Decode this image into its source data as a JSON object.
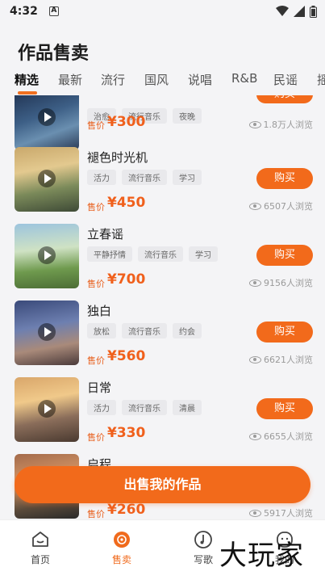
{
  "statusbar": {
    "time": "4:32"
  },
  "page": {
    "title": "作品售卖"
  },
  "tabs": [
    "精选",
    "最新",
    "流行",
    "国风",
    "说唱",
    "R&B",
    "民谣",
    "摇"
  ],
  "items": [
    {
      "title": "",
      "tags": [
        "治愈",
        "流行音乐",
        "夜晚"
      ],
      "price_label": "售价",
      "price": "¥300",
      "views": "1.8万人浏览",
      "buy": "购买"
    },
    {
      "title": "褪色时光机",
      "tags": [
        "活力",
        "流行音乐",
        "学习"
      ],
      "price_label": "售价",
      "price": "¥450",
      "views": "6507人浏览",
      "buy": "购买"
    },
    {
      "title": "立春谣",
      "tags": [
        "平静抒情",
        "流行音乐",
        "学习"
      ],
      "price_label": "售价",
      "price": "¥700",
      "views": "9156人浏览",
      "buy": "购买"
    },
    {
      "title": "独白",
      "tags": [
        "放松",
        "流行音乐",
        "约会"
      ],
      "price_label": "售价",
      "price": "¥560",
      "views": "6621人浏览",
      "buy": "购买"
    },
    {
      "title": "日常",
      "tags": [
        "活力",
        "流行音乐",
        "清晨"
      ],
      "price_label": "售价",
      "price": "¥330",
      "views": "6655人浏览",
      "buy": "购买"
    },
    {
      "title": "启程",
      "tags": [],
      "price_label": "售价",
      "price": "¥260",
      "views": "5917人浏览",
      "buy": ""
    }
  ],
  "sell_button": "出售我的作品",
  "nav": [
    {
      "label": "首页",
      "icon": "home-icon"
    },
    {
      "label": "售卖",
      "icon": "vinyl-icon"
    },
    {
      "label": "写歌",
      "icon": "music-note-icon"
    },
    {
      "label": "我的",
      "icon": "profile-icon"
    }
  ],
  "watermark": "大玩家"
}
